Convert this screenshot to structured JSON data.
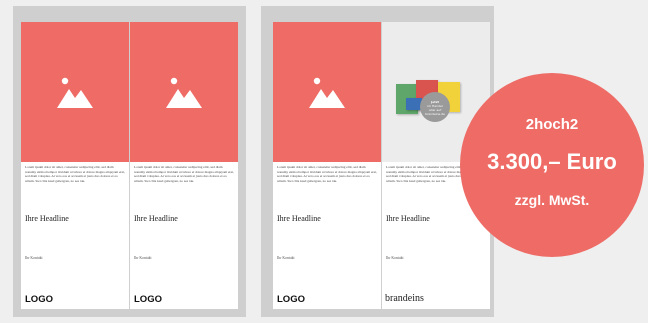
{
  "pages": [
    {
      "body_text": "Lorem ipsum dolor sit amet, consetetur sadipscing elitr, sed diam nonumy eirmod tempor invidunt ut labore et dolore magna aliquyam erat, sed diam voluptua. At vero eos et accusam et justo duo dolores et ea rebum. Stet clita kasd gubergren, no sea tak.",
      "headline": "Ihre Headline",
      "contact": "Ihr Kontakt",
      "logo": "LOGO"
    },
    {
      "body_text": "Lorem ipsum dolor sit amet, consetetur sadipscing elitr, sed diam nonumy eirmod tempor invidunt ut labore et dolore magna aliquyam erat, sed diam voluptua. At vero eos et accusam et justo duo dolores et ea rebum. Stet clita kasd gubergren, no sea tak.",
      "headline": "Ihre Headline",
      "contact": "Ihr Kontakt",
      "logo": "LOGO"
    },
    {
      "body_text": "Lorem ipsum dolor sit amet, consetetur sadipscing elitr, sed diam nonumy eirmod tempor invidunt ut labore et dolore magna aliquyam erat, sed diam voluptua. At vero eos et accusam et justo duo dolores et ea rebum. Stet clita kasd gubergren, no sea tak.",
      "headline": "Ihre Headline",
      "contact": "Ihr Kontakt",
      "logo": "LOGO"
    },
    {
      "body_text": "Lorem ipsum dolor sit amet, consetetur sadipscing elitr, sed diam nonumy eirmod tempor invidunt ut labore et dolore magna aliquyam erat, sed diam voluptua. At vero eos et accusam et justo duo dolores et ea rebum. Stet clita kasd gubergren, no sea tak.",
      "headline": "Ihre Headline",
      "contact": "Ihr Kontakt",
      "brand": "brandeins"
    }
  ],
  "sticker_text": "Jetzt im Handel oder auf brandeins.de",
  "promo": {
    "product": "2hoch2",
    "price": "3.300,– Euro",
    "tax": "zzgl. MwSt."
  },
  "icons": {
    "image_placeholder": "image-placeholder-icon"
  },
  "colors": {
    "accent": "#ee6b66",
    "page_background": "#efefef",
    "spread_background": "#cfcfcf",
    "magazine_green": "#5ea66a",
    "magazine_red": "#d9534f",
    "magazine_yellow": "#f2d23b"
  }
}
